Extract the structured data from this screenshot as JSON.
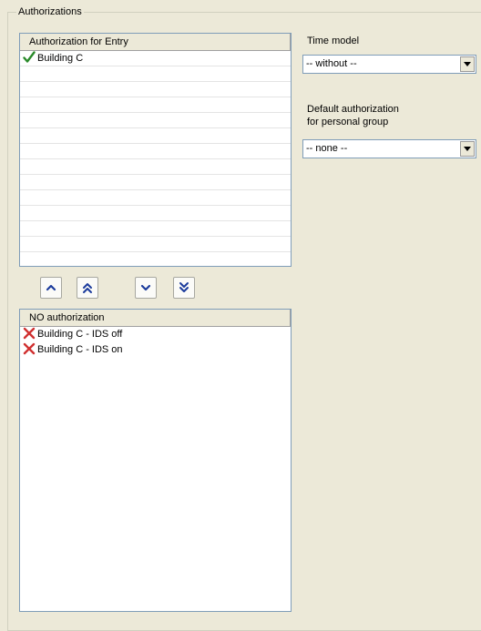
{
  "group": {
    "title": "Authorizations"
  },
  "authorized_list": {
    "header": "Authorization for Entry",
    "items": [
      {
        "label": "Building C",
        "icon": "checkmark-icon"
      }
    ]
  },
  "move_buttons": {
    "up": "chevron-up-icon",
    "all_up": "double-chevron-up-icon",
    "down": "chevron-down-icon",
    "all_down": "double-chevron-down-icon"
  },
  "unauthorized_list": {
    "header": "NO authorization",
    "items": [
      {
        "label": "Building C - IDS off",
        "icon": "cross-icon"
      },
      {
        "label": "Building C - IDS on",
        "icon": "cross-icon"
      }
    ]
  },
  "time_model": {
    "label": "Time model",
    "value": "-- without --"
  },
  "default_auth": {
    "label_line1": "Default authorization",
    "label_line2": "for personal group",
    "value": "-- none --"
  },
  "colors": {
    "check": "#2a8a2a",
    "cross": "#d03030",
    "arrow": "#1c3c9c"
  }
}
